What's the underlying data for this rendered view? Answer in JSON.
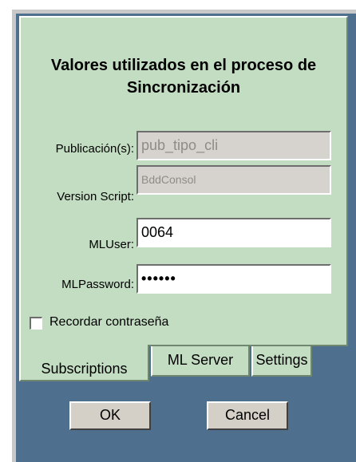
{
  "dialog": {
    "title": "Valores utilizados en el proceso de Sincronización"
  },
  "fields": {
    "publicacion": {
      "label": "Publicación(s):",
      "value": "pub_tipo_cli"
    },
    "version_script": {
      "label": "Version Script:",
      "value": "BddConsol"
    },
    "ml_user": {
      "label": "MLUser:",
      "value": "0064"
    },
    "ml_password": {
      "label": "MLPassword:",
      "value": "••••••"
    }
  },
  "remember": {
    "label": "Recordar contraseña",
    "checked": false
  },
  "tabs": [
    {
      "label": "Subscriptions",
      "active": true
    },
    {
      "label": "ML Server",
      "active": false
    },
    {
      "label": "Settings",
      "active": false
    }
  ],
  "buttons": {
    "ok": "OK",
    "cancel": "Cancel"
  }
}
